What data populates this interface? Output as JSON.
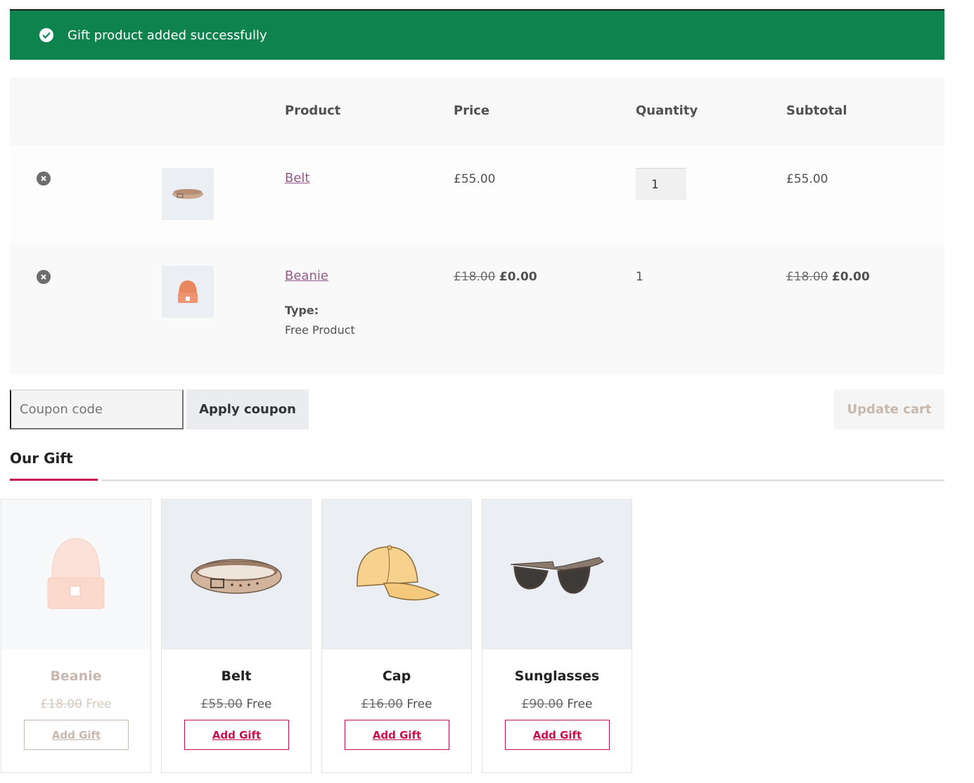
{
  "notice": {
    "message": "Gift product added successfully",
    "color": "#0f834d"
  },
  "cart": {
    "headers": {
      "product": "Product",
      "price": "Price",
      "quantity": "Quantity",
      "subtotal": "Subtotal"
    },
    "rows": [
      {
        "name": "Belt",
        "price": "£55.00",
        "quantity": "1",
        "subtotal": "£55.00",
        "thumb_icon": "belt-icon"
      },
      {
        "name": "Beanie",
        "price_old": "£18.00",
        "price": "£0.00",
        "quantity": "1",
        "subtotal_old": "£18.00",
        "subtotal": "£0.00",
        "meta_label": "Type:",
        "meta_value": "Free Product",
        "thumb_icon": "beanie-icon"
      }
    ]
  },
  "actions": {
    "coupon_placeholder": "Coupon code",
    "apply_label": "Apply coupon",
    "update_label": "Update cart"
  },
  "gifts": {
    "title": "Our Gift",
    "accent": "#c9104e",
    "items": [
      {
        "name": "Beanie",
        "price_old": "£18.00",
        "price": "Free",
        "button": "Add Gift",
        "icon": "beanie-icon",
        "state": "disabled"
      },
      {
        "name": "Belt",
        "price_old": "£55.00",
        "price": "Free",
        "button": "Add Gift",
        "icon": "belt-icon",
        "state": "enabled"
      },
      {
        "name": "Cap",
        "price_old": "£16.00",
        "price": "Free",
        "button": "Add Gift",
        "icon": "cap-icon",
        "state": "enabled"
      },
      {
        "name": "Sunglasses",
        "price_old": "£90.00",
        "price": "Free",
        "button": "Add Gift",
        "icon": "sunglasses-icon",
        "state": "enabled"
      }
    ]
  }
}
